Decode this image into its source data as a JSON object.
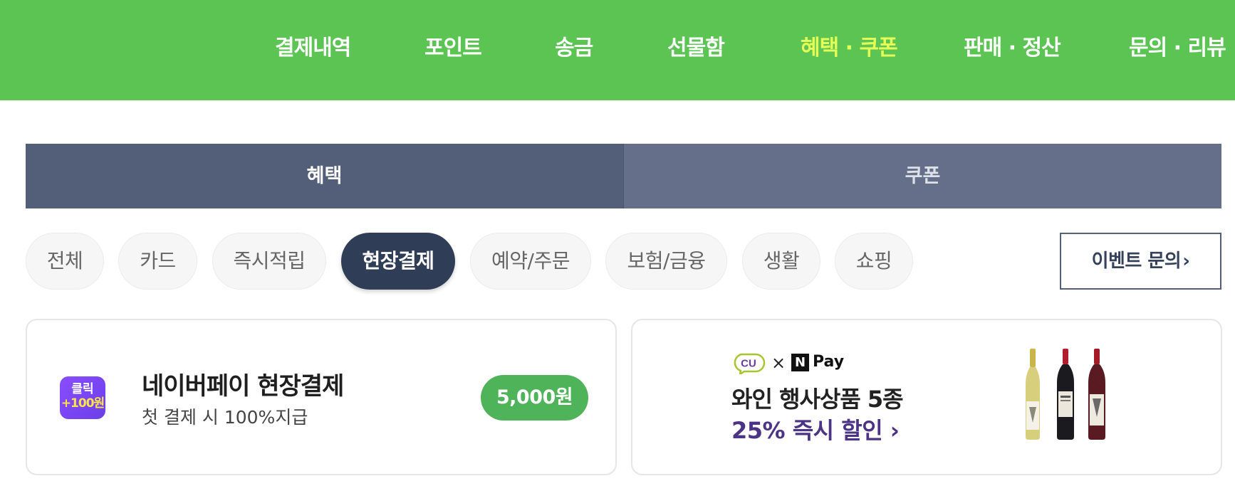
{
  "header": {
    "nav": [
      {
        "label": "결제내역"
      },
      {
        "label": "포인트"
      },
      {
        "label": "송금"
      },
      {
        "label": "선물함"
      },
      {
        "label": "혜택 · 쿠폰"
      },
      {
        "label": "판매 · 정산"
      },
      {
        "label": "문의 · 리뷰"
      }
    ],
    "active_index": 4
  },
  "tabs": [
    {
      "label": "혜택"
    },
    {
      "label": "쿠폰"
    }
  ],
  "filters": {
    "chips": [
      {
        "label": "전체"
      },
      {
        "label": "카드"
      },
      {
        "label": "즉시적립"
      },
      {
        "label": "현장결제"
      },
      {
        "label": "예약/주문"
      },
      {
        "label": "보험/금융"
      },
      {
        "label": "생활"
      },
      {
        "label": "쇼핑"
      }
    ],
    "active_index": 3,
    "inquiry_label": "이벤트 문의",
    "inquiry_chevron": "›"
  },
  "cards": {
    "benefit": {
      "badge_line1": "클릭",
      "badge_line2": "+100원",
      "title": "네이버페이 현장결제",
      "subtitle": "첫 결제 시 100%지급",
      "amount": "5,000원"
    },
    "ad": {
      "brand_cu": "CU",
      "brand_x": "×",
      "brand_n": "N",
      "brand_pay": "Pay",
      "title": "와인 행사상품 5종",
      "discount": "25% 즉시 할인 ›"
    }
  },
  "colors": {
    "header_bg": "#5bc453",
    "nav_active": "#e4ff55",
    "tab_active": "#535f78",
    "tab_inactive": "#656f89",
    "chip_active": "#2f3d57",
    "amount_pill": "#4fb35a",
    "badge_purple": "#7a45f2",
    "ad_discount": "#4b3385"
  },
  "icons": [
    "chevron-right-icon",
    "cu-logo",
    "npay-logo",
    "wine-bottles-image"
  ]
}
